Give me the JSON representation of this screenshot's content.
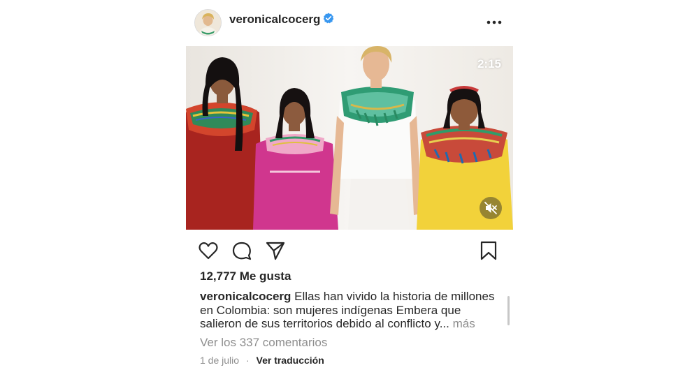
{
  "header": {
    "username": "veronicalcocerg",
    "avatar_icon": "profile-avatar",
    "verified_icon": "verified-badge-icon",
    "more_icon": "more-dots-icon"
  },
  "media": {
    "duration": "2:15",
    "mute_icon": "muted-speaker-icon"
  },
  "actions": {
    "like_icon": "heart-icon",
    "comment_icon": "comment-bubble-icon",
    "share_icon": "paper-plane-icon",
    "save_icon": "bookmark-icon"
  },
  "likes": "12,777 Me gusta",
  "caption": {
    "username": "veronicalcocerg",
    "text": "Ellas han vivido la historia de millones en Colombia: son mujeres indígenas Embera que salieron de sus territorios debido al conflicto y...",
    "more_label": "más"
  },
  "comments_link": "Ver los 337 comentarios",
  "footer": {
    "date": "1 de julio",
    "separator": "·",
    "translate_label": "Ver traducción"
  },
  "colors": {
    "verified": "#3897f0",
    "text": "#262626",
    "muted": "#8e8e8e"
  }
}
